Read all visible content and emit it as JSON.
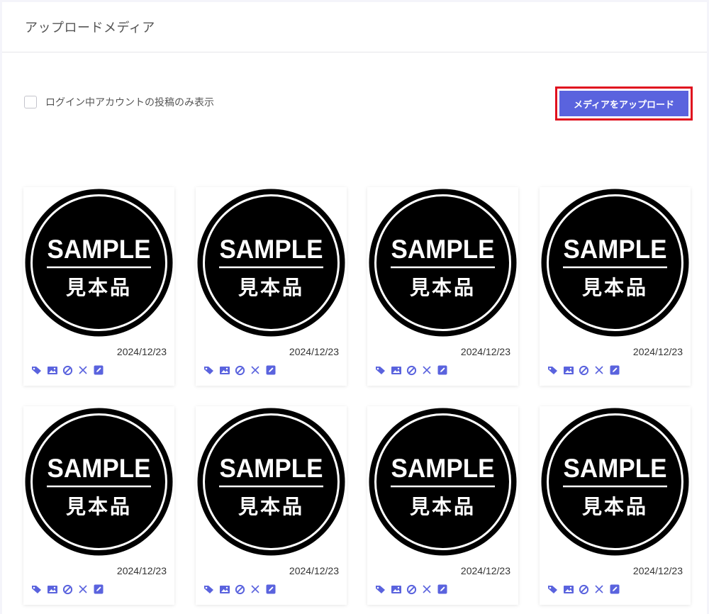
{
  "header": {
    "title": "アップロードメディア"
  },
  "filter": {
    "label": "ログイン中アカウントの投稿のみ表示",
    "checked": false
  },
  "upload_button": {
    "label": "メディアをアップロード"
  },
  "accent_color": "#5a63de",
  "highlight_color": "#e0101e",
  "action_icons": [
    "tag-icon",
    "image-icon",
    "block-icon",
    "close-icon",
    "edit-icon"
  ],
  "media": [
    {
      "title": "SAMPLE",
      "subtitle": "見本品",
      "date": "2024/12/23"
    },
    {
      "title": "SAMPLE",
      "subtitle": "見本品",
      "date": "2024/12/23"
    },
    {
      "title": "SAMPLE",
      "subtitle": "見本品",
      "date": "2024/12/23"
    },
    {
      "title": "SAMPLE",
      "subtitle": "見本品",
      "date": "2024/12/23"
    },
    {
      "title": "SAMPLE",
      "subtitle": "見本品",
      "date": "2024/12/23"
    },
    {
      "title": "SAMPLE",
      "subtitle": "見本品",
      "date": "2024/12/23"
    },
    {
      "title": "SAMPLE",
      "subtitle": "見本品",
      "date": "2024/12/23"
    },
    {
      "title": "SAMPLE",
      "subtitle": "見本品",
      "date": "2024/12/23"
    }
  ]
}
